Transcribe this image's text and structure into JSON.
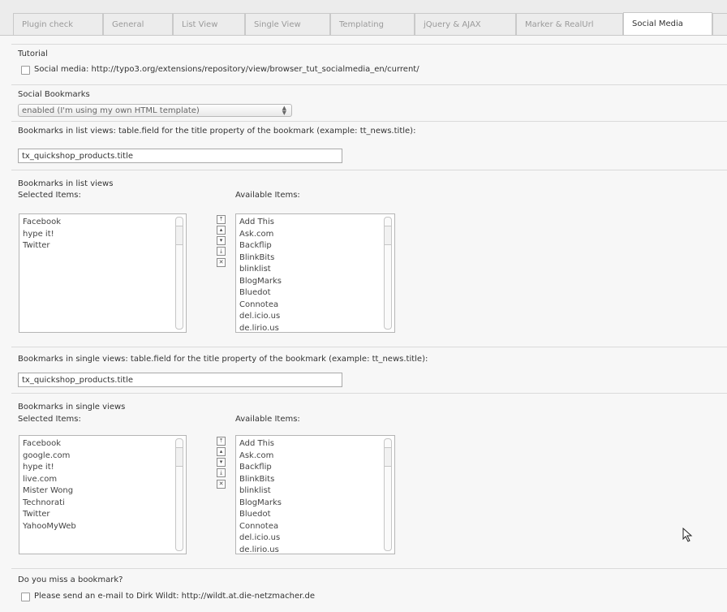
{
  "tabs": [
    {
      "label": "Plugin check"
    },
    {
      "label": "General"
    },
    {
      "label": "List View"
    },
    {
      "label": "Single View"
    },
    {
      "label": "Templating"
    },
    {
      "label": "jQuery & AJAX"
    },
    {
      "label": "Marker & RealUrl"
    },
    {
      "label": "Social Media"
    }
  ],
  "active_tab": "Social Media",
  "tutorial": {
    "heading": "Tutorial",
    "link_text": "Social media: http://typo3.org/extensions/repository/view/browser_tut_socialmedia_en/current/"
  },
  "social_bookmarks": {
    "heading": "Social Bookmarks",
    "selected": "enabled (I'm using my own HTML template)"
  },
  "list_title_field": {
    "label": "Bookmarks in list views: table.field for the title property of the bookmark (example: tt_news.title):",
    "value": "tx_quickshop_products.title"
  },
  "list_views": {
    "heading": "Bookmarks in list views",
    "selected_label": "Selected Items:",
    "available_label": "Available Items:",
    "selected_items": [
      "Facebook",
      "hype it!",
      "Twitter"
    ],
    "available_items": [
      "Add This",
      "Ask.com",
      "Backflip",
      "BlinkBits",
      "blinklist",
      "BlogMarks",
      "Bluedot",
      "Connotea",
      "del.icio.us",
      "de.lirio.us"
    ]
  },
  "single_title_field": {
    "label": "Bookmarks in single views: table.field for the title property of the bookmark (example: tt_news.title):",
    "value": "tx_quickshop_products.title"
  },
  "single_views": {
    "heading": "Bookmarks in single views",
    "selected_label": "Selected Items:",
    "available_label": "Available Items:",
    "selected_items": [
      "Facebook",
      "google.com",
      "hype it!",
      "live.com",
      "Mister Wong",
      "Technorati",
      "Twitter",
      "YahooMyWeb"
    ],
    "available_items": [
      "Add This",
      "Ask.com",
      "Backflip",
      "BlinkBits",
      "blinklist",
      "BlogMarks",
      "Bluedot",
      "Connotea",
      "del.icio.us",
      "de.lirio.us"
    ]
  },
  "missing": {
    "heading": "Do you miss a bookmark?",
    "text": "Please send an e-mail to Dirk Wildt: http://wildt.at.die-netzmacher.de"
  },
  "icons": {
    "move_top": "arrow-top-icon",
    "move_up": "arrow-up-icon",
    "move_down": "arrow-down-icon",
    "move_bottom": "arrow-bottom-icon",
    "remove": "remove-icon",
    "cursor": "mouse-cursor-icon"
  }
}
